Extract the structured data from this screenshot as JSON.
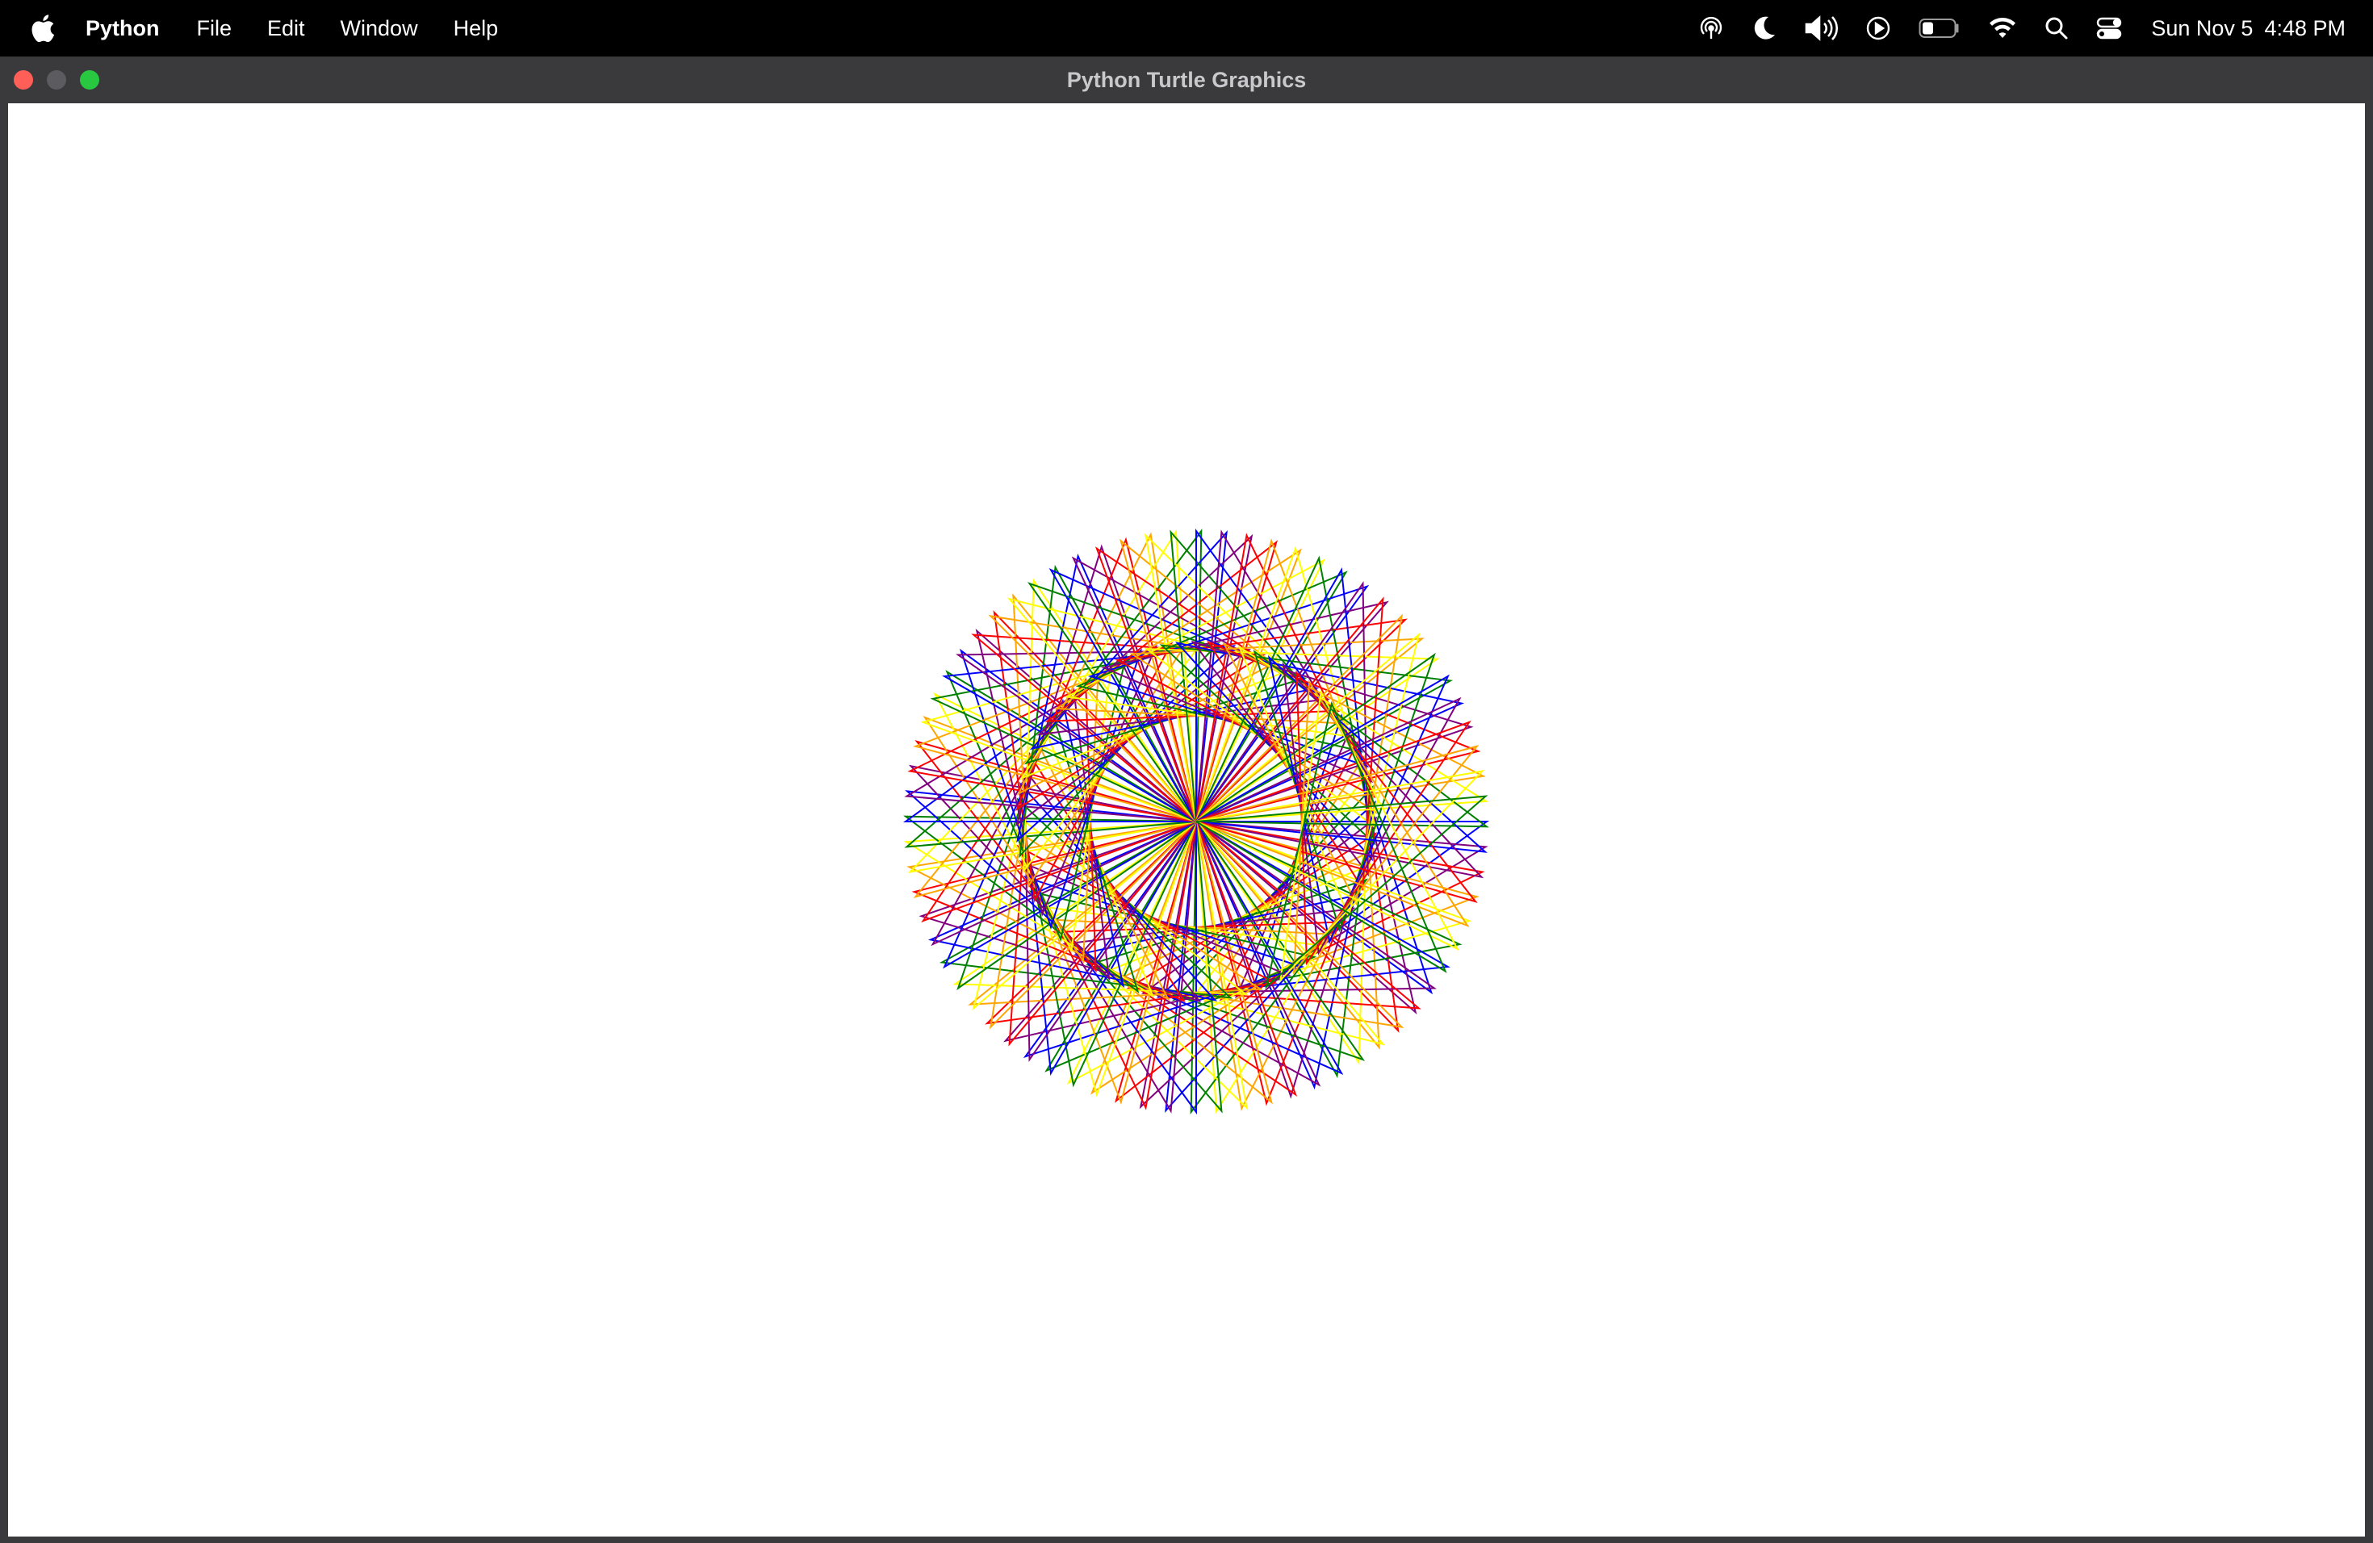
{
  "menubar": {
    "apple_icon": "apple-logo-icon",
    "app_name": "Python",
    "items": [
      {
        "label": "File"
      },
      {
        "label": "Edit"
      },
      {
        "label": "Window"
      },
      {
        "label": "Help"
      }
    ],
    "status_icons": [
      "airdrop-icon",
      "moon-icon",
      "volume-icon",
      "play-icon",
      "battery-icon",
      "wifi-icon",
      "search-icon",
      "control-center-icon"
    ],
    "clock": {
      "date": "Sun Nov 5",
      "time": "4:48 PM"
    }
  },
  "window": {
    "title": "Python Turtle Graphics",
    "traffic_lights": {
      "close": "#ff5f57",
      "minimize": "#5c5b5f",
      "maximize": "#28c840"
    }
  },
  "drawing": {
    "description": "turtle spirograph",
    "pen_colors": [
      "#0000ff",
      "#800080",
      "#ff0000",
      "#ffa500",
      "#ffff00",
      "#008000"
    ],
    "line_count": 72
  }
}
